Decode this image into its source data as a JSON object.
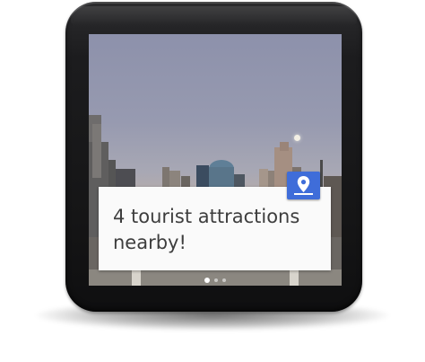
{
  "notification": {
    "text": "4 tourist attractions nearby!",
    "icon": "map-pin-icon",
    "icon_color": "#3f6dd9"
  },
  "pager": {
    "pages": 3,
    "active_index": 0
  },
  "device": {
    "type": "Android Wear square watch"
  }
}
